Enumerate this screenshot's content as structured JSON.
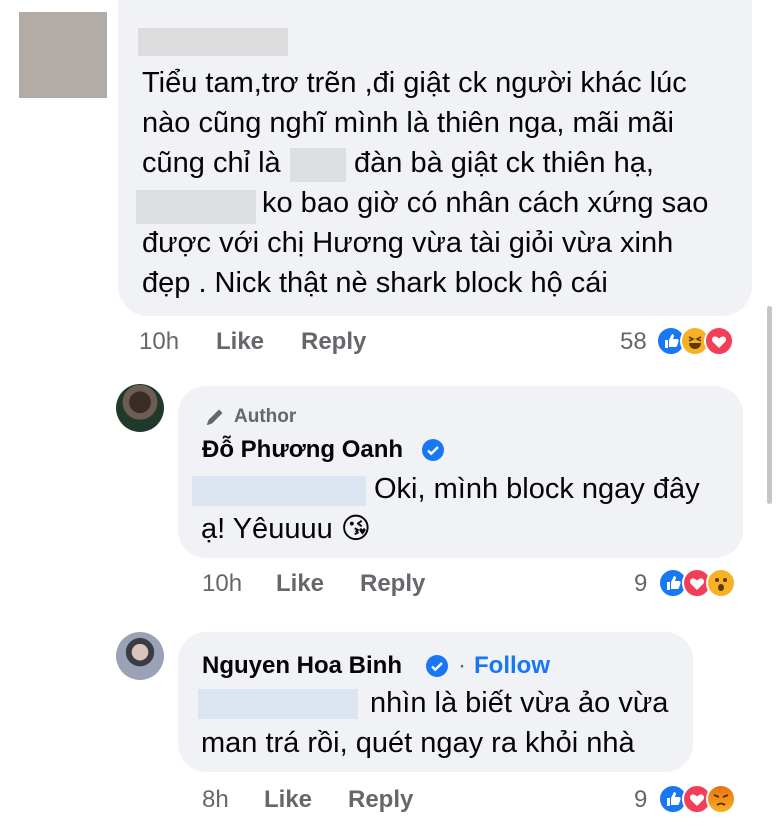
{
  "comments": [
    {
      "text_line1": "Tiểu tam,trơ trẽn ,đi giật ck người khác lúc",
      "text_line2": "nào cũng nghĩ mình là thiên nga, mãi mãi",
      "text_line3a": "cũng chỉ là",
      "text_line3b": "đàn bà giật ck thiên hạ,",
      "text_line4": "ko bao giờ có nhân cách xứng sao",
      "text_line5": "được với chị Hương vừa tài giỏi vừa xinh",
      "text_line6": "đẹp . Nick thật nè shark block hộ cái",
      "time": "10h",
      "like_label": "Like",
      "reply_label": "Reply",
      "reaction_count": "58",
      "reactions": [
        "like",
        "haha",
        "love"
      ]
    },
    {
      "author_label": "Author",
      "name": "Đỗ Phương Oanh",
      "verified": true,
      "text_line1": "Oki, mình block ngay đây",
      "text_line2": "ạ! Yêuuuu 😘",
      "time": "10h",
      "like_label": "Like",
      "reply_label": "Reply",
      "reaction_count": "9",
      "reactions": [
        "like",
        "love",
        "wow"
      ]
    },
    {
      "name": "Nguyen Hoa Binh",
      "verified": true,
      "separator": "·",
      "follow_label": "Follow",
      "text_line1": "nhìn là biết vừa ảo vừa",
      "text_line2": "man trá rồi, quét ngay ra khỏi nhà",
      "time": "8h",
      "like_label": "Like",
      "reply_label": "Reply",
      "reaction_count": "9",
      "reactions": [
        "like",
        "love",
        "angry"
      ]
    }
  ],
  "colors": {
    "bubble": "#f0f2f5",
    "meta_text": "#65676b",
    "link_blue": "#1877f2",
    "like_blue": "#1877f2",
    "love_red": "#f33e58",
    "haha_yellow": "#f7b125"
  }
}
